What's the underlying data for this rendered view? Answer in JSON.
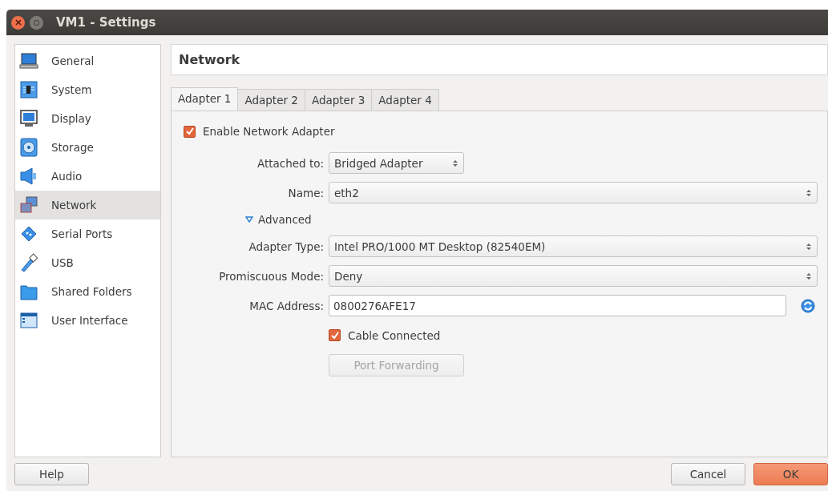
{
  "window": {
    "title": "VM1 - Settings"
  },
  "sidebar": {
    "items": [
      {
        "label": "General",
        "kind": "general",
        "selected": false
      },
      {
        "label": "System",
        "kind": "system",
        "selected": false
      },
      {
        "label": "Display",
        "kind": "display",
        "selected": false
      },
      {
        "label": "Storage",
        "kind": "storage",
        "selected": false
      },
      {
        "label": "Audio",
        "kind": "audio",
        "selected": false
      },
      {
        "label": "Network",
        "kind": "network",
        "selected": true
      },
      {
        "label": "Serial Ports",
        "kind": "serial",
        "selected": false
      },
      {
        "label": "USB",
        "kind": "usb",
        "selected": false
      },
      {
        "label": "Shared Folders",
        "kind": "folder",
        "selected": false
      },
      {
        "label": "User Interface",
        "kind": "ui",
        "selected": false
      }
    ]
  },
  "page_title": "Network",
  "tabs": [
    {
      "label": "Adapter 1",
      "selected": true
    },
    {
      "label": "Adapter 2",
      "selected": false
    },
    {
      "label": "Adapter 3",
      "selected": false
    },
    {
      "label": "Adapter 4",
      "selected": false
    }
  ],
  "enable_adapter": {
    "label": "Enable Network Adapter",
    "checked": true
  },
  "basic_fields": [
    {
      "label": "Attached to:",
      "kind": "short-combo",
      "value": "Bridged Adapter"
    },
    {
      "label": "Name:",
      "kind": "combo",
      "value": "eth2"
    }
  ],
  "advanced": {
    "label": "Advanced",
    "expanded": true
  },
  "advanced_fields": [
    {
      "label": "Adapter Type:",
      "kind": "combo",
      "value": "Intel PRO/1000 MT Desktop (82540EM)"
    },
    {
      "label": "Promiscuous Mode:",
      "kind": "combo",
      "value": "Deny"
    },
    {
      "label": "MAC Address:",
      "kind": "text",
      "value": "0800276AFE17"
    }
  ],
  "cable_connected": {
    "label": "Cable Connected",
    "checked": true
  },
  "port_forwarding": {
    "label": "Port Forwarding",
    "disabled": true
  },
  "buttons": [
    {
      "label": "Help",
      "default": false
    },
    {
      "label": "Cancel",
      "default": false
    },
    {
      "label": "OK",
      "default": true
    }
  ]
}
